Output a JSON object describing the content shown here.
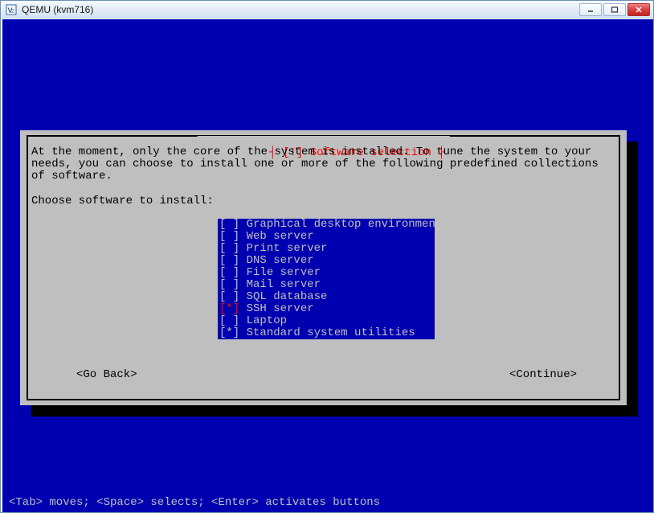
{
  "window": {
    "title": "QEMU (kvm716)",
    "buttons": {
      "min": "_",
      "max": "□",
      "close": "✕"
    }
  },
  "dialog": {
    "title": "[!] Software selection",
    "intro": "At the moment, only the core of the system is installed. To tune the system to your needs, you can choose to install one or more of the following predefined collections of software.",
    "prompt": "Choose software to install:",
    "options": [
      {
        "label": "Graphical desktop environment",
        "checked": false,
        "cursor": false
      },
      {
        "label": "Web server",
        "checked": false,
        "cursor": false
      },
      {
        "label": "Print server",
        "checked": false,
        "cursor": false
      },
      {
        "label": "DNS server",
        "checked": false,
        "cursor": false
      },
      {
        "label": "File server",
        "checked": false,
        "cursor": false
      },
      {
        "label": "Mail server",
        "checked": false,
        "cursor": false
      },
      {
        "label": "SQL database",
        "checked": false,
        "cursor": false
      },
      {
        "label": "SSH server",
        "checked": true,
        "cursor": true
      },
      {
        "label": "Laptop",
        "checked": false,
        "cursor": false
      },
      {
        "label": "Standard system utilities",
        "checked": true,
        "cursor": false
      }
    ],
    "go_back": "<Go Back>",
    "continue": "<Continue>"
  },
  "footer": "<Tab> moves; <Space> selects; <Enter> activates buttons"
}
